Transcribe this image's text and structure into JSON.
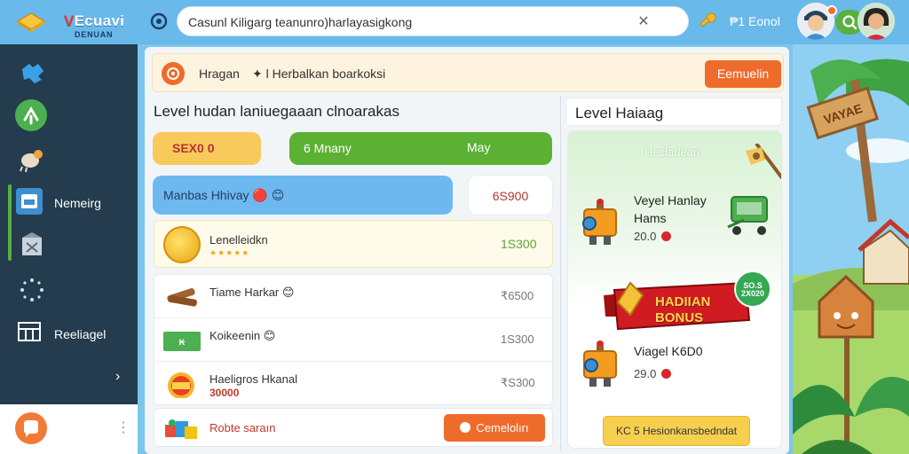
{
  "header": {
    "logo_title_v": "V",
    "logo_title_rest": "Ecuavi",
    "logo_subtitle": "DENUAN",
    "search_text": "Casunl Kiligarg teanunro)harlayasigkong",
    "clear_icon": "close-icon",
    "search_icon": "search-icon",
    "coins_label": "₱1 Eonol",
    "colors": {
      "bar": "#69b9ea",
      "search_btn": "#58b041",
      "notif": "#f36d2a"
    }
  },
  "sidebar": {
    "items": [
      {
        "icon": "puzzle-icon",
        "label": ""
      },
      {
        "icon": "tools-icon",
        "label": ""
      },
      {
        "icon": "bird-icon",
        "label": ""
      },
      {
        "icon": "calendar-icon",
        "label": "Nemeirg"
      },
      {
        "icon": "bag-icon",
        "label": ""
      },
      {
        "icon": "sparkle-icon",
        "label": ""
      },
      {
        "icon": "grid-icon",
        "label": "Reeliagel"
      }
    ],
    "more_icon": "chevron-right-icon",
    "footer_icon": "chat-icon",
    "footer_menu_icon": "dots-icon"
  },
  "banner": {
    "title": "Hragan",
    "subtitle": "✦ l Herbalkan boarkoksi",
    "button": "Eemuelin"
  },
  "left": {
    "title": "Level hudan laniuegaaan clnoarakas",
    "pill_yellow": "SEX0 0",
    "pill_green_a": "6 Mnany",
    "pill_green_b": "May",
    "pill_blue": "Manbas Hhivay 🔴 😊",
    "pill_white": "6S900",
    "featured": {
      "name": "Lenelleidkn",
      "stars": "★★★★★",
      "value": "1S300"
    },
    "rows": [
      {
        "icon": "wood-icon",
        "name": "Tiame Harkar 😊",
        "sub": "",
        "value": "₹6500"
      },
      {
        "icon": "ticket-icon",
        "name": "Koikeenin 😊",
        "sub": "",
        "value": "1S300"
      },
      {
        "icon": "chest-icon",
        "name": "Haeligros Hkanal",
        "sub": "30000",
        "value": "₹S300"
      }
    ],
    "bottom": {
      "name": "Robte saraın",
      "button": "Cemelolırı"
    }
  },
  "right": {
    "title": "Level Haiaag",
    "panel_header": "Heclarlean",
    "item1": {
      "name": "Veyel Hanlay Hams",
      "value": "20.0"
    },
    "bonus_label_line1": "HADIIAN",
    "bonus_label_line2": "BONUS",
    "bonus_badge": "SO.S 2X020",
    "item2": {
      "name": "Viagel K6D0",
      "value": "29.0"
    },
    "cta": "KC 5 Hesionkansbedndat"
  },
  "scenery": {
    "sign_text": "VAYAE"
  }
}
